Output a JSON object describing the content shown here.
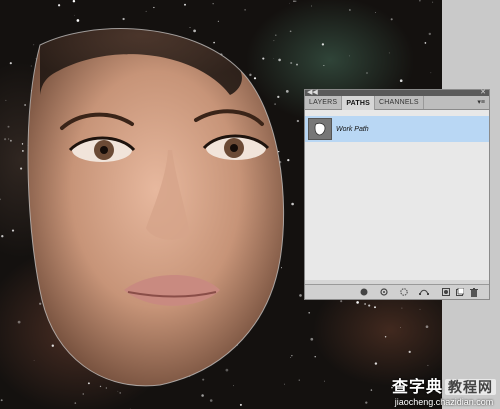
{
  "panel": {
    "tabs": [
      {
        "label": "LAYERS",
        "active": false
      },
      {
        "label": "PATHS",
        "active": true
      },
      {
        "label": "CHANNELS",
        "active": false
      }
    ],
    "paths": [
      {
        "name": "Work Path",
        "selected": true
      }
    ],
    "selection_color": "#b9d7f4",
    "bottom_icons": [
      "fill-path-icon",
      "stroke-path-icon",
      "load-selection-icon",
      "make-work-path-icon",
      "mask-icon",
      "new-path-icon",
      "delete-path-icon"
    ]
  },
  "watermark": {
    "logo_text": "查字典",
    "logo_badge": "教程网",
    "url": "jiaocheng.chazidian.com"
  },
  "colors": {
    "work_area": "#c9c9c9",
    "panel_bg": "#d6d6d6"
  }
}
